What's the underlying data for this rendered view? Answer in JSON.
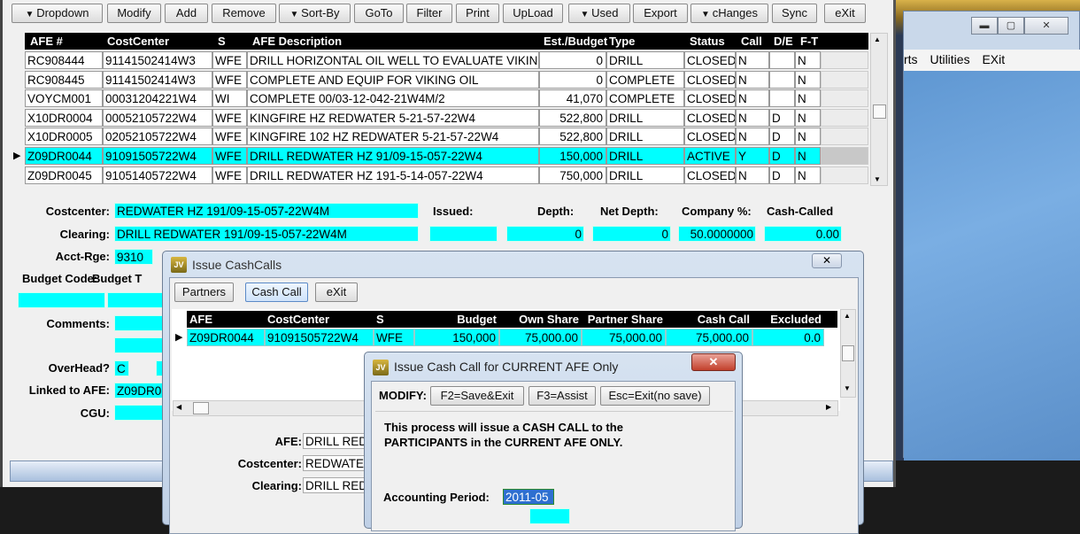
{
  "toolbar": {
    "buttons": [
      "Dropdown",
      "Modify",
      "Add",
      "Remove",
      "Sort-By",
      "GoTo",
      "Filter",
      "Print",
      "UpLoad",
      "Used",
      "Export",
      "cHanges",
      "Sync",
      "eXit"
    ]
  },
  "afe_grid": {
    "columns": [
      "AFE #",
      "CostCenter",
      "S",
      "AFE Description",
      "Est./Budget",
      "Type",
      "Status",
      "Call",
      "D/E",
      "F-T"
    ],
    "rows": [
      [
        "RC908444",
        "91141502414W3",
        "WFE",
        "DRILL HORIZONTAL OIL WELL TO EVALUATE VIKING",
        "0",
        "DRILL",
        "CLOSED",
        "N",
        "",
        "N"
      ],
      [
        "RC908445",
        "91141502414W3",
        "WFE",
        "COMPLETE AND EQUIP FOR VIKING OIL",
        "0",
        "COMPLETE",
        "CLOSED",
        "N",
        "",
        "N"
      ],
      [
        "VOYCM001",
        "00031204221W4",
        "WI",
        "COMPLETE 00/03-12-042-21W4M/2",
        "41,070",
        "COMPLETE",
        "CLOSED",
        "N",
        "",
        "N"
      ],
      [
        "X10DR0004",
        "00052105722W4",
        "WFE",
        "KINGFIRE HZ REDWATER 5-21-57-22W4",
        "522,800",
        "DRILL",
        "CLOSED",
        "N",
        "D",
        "N"
      ],
      [
        "X10DR0005",
        "02052105722W4",
        "WFE",
        "KINGFIRE 102 HZ REDWATER 5-21-57-22W4",
        "522,800",
        "DRILL",
        "CLOSED",
        "N",
        "D",
        "N"
      ],
      [
        "Z09DR0044",
        "91091505722W4",
        "WFE",
        "DRILL REDWATER HZ 91/09-15-057-22W4",
        "150,000",
        "DRILL",
        "ACTIVE",
        "Y",
        "D",
        "N"
      ],
      [
        "Z09DR0045",
        "91051405722W4",
        "WFE",
        "DRILL REDWATER HZ 191-5-14-057-22W4",
        "750,000",
        "DRILL",
        "CLOSED",
        "N",
        "D",
        "N"
      ]
    ],
    "selected_row": 5
  },
  "detail": {
    "costcenter_label": "Costcenter:",
    "costcenter": "REDWATER HZ 191/09-15-057-22W4M",
    "clearing_label": "Clearing:",
    "clearing": "DRILL REDWATER 191/09-15-057-22W4M",
    "acct_rge_label": "Acct-Rge:",
    "acct_rge": "9310",
    "budget_code_label": "Budget Code:",
    "budget_t_label": "Budget T",
    "comments_label": "Comments:",
    "overhead_label": "OverHead?",
    "overhead": "C",
    "linked_label": "Linked to AFE:",
    "linked": "Z09DR0",
    "cgu_label": "CGU:",
    "issued_label": "Issued:",
    "depth_label": "Depth:",
    "depth": "0",
    "net_depth_label": "Net Depth:",
    "net_depth": "0",
    "company_pct_label": "Company %:",
    "company_pct": "50.0000000",
    "cash_called_label": "Cash-Called",
    "cash_called": "0.00"
  },
  "bg_window": {
    "menu": [
      "rts",
      "Utilities",
      "EXit"
    ]
  },
  "cashcalls_dialog": {
    "title": "Issue CashCalls",
    "buttons": [
      "Partners",
      "Cash Call",
      "eXit"
    ],
    "columns": [
      "AFE",
      "CostCenter",
      "S",
      "Budget",
      "Own Share",
      "Partner Share",
      "Cash Call",
      "Excluded"
    ],
    "row": [
      "Z09DR0044",
      "91091505722W4",
      "WFE",
      "150,000",
      "75,000.00",
      "75,000.00",
      "75,000.00",
      "0.0"
    ],
    "afe_label": "AFE:",
    "afe": "DRILL RED",
    "costcenter_label": "Costcenter:",
    "costcenter": "REDWATE",
    "clearing_label": "Clearing:",
    "clearing": "DRILL RED"
  },
  "current_dialog": {
    "title": "Issue Cash Call for CURRENT AFE Only",
    "modify_label": "MODIFY:",
    "buttons": [
      "F2=Save&Exit",
      "F3=Assist",
      "Esc=Exit(no save)"
    ],
    "message_line1": "This process will issue a CASH CALL to the",
    "message_line2": "PARTICIPANTS in the CURRENT AFE ONLY.",
    "period_label": "Accounting Period:",
    "period": "2011-05"
  },
  "colors": {
    "highlight": "#00ffff",
    "header": "#000000",
    "selection": "#3a78d6"
  }
}
